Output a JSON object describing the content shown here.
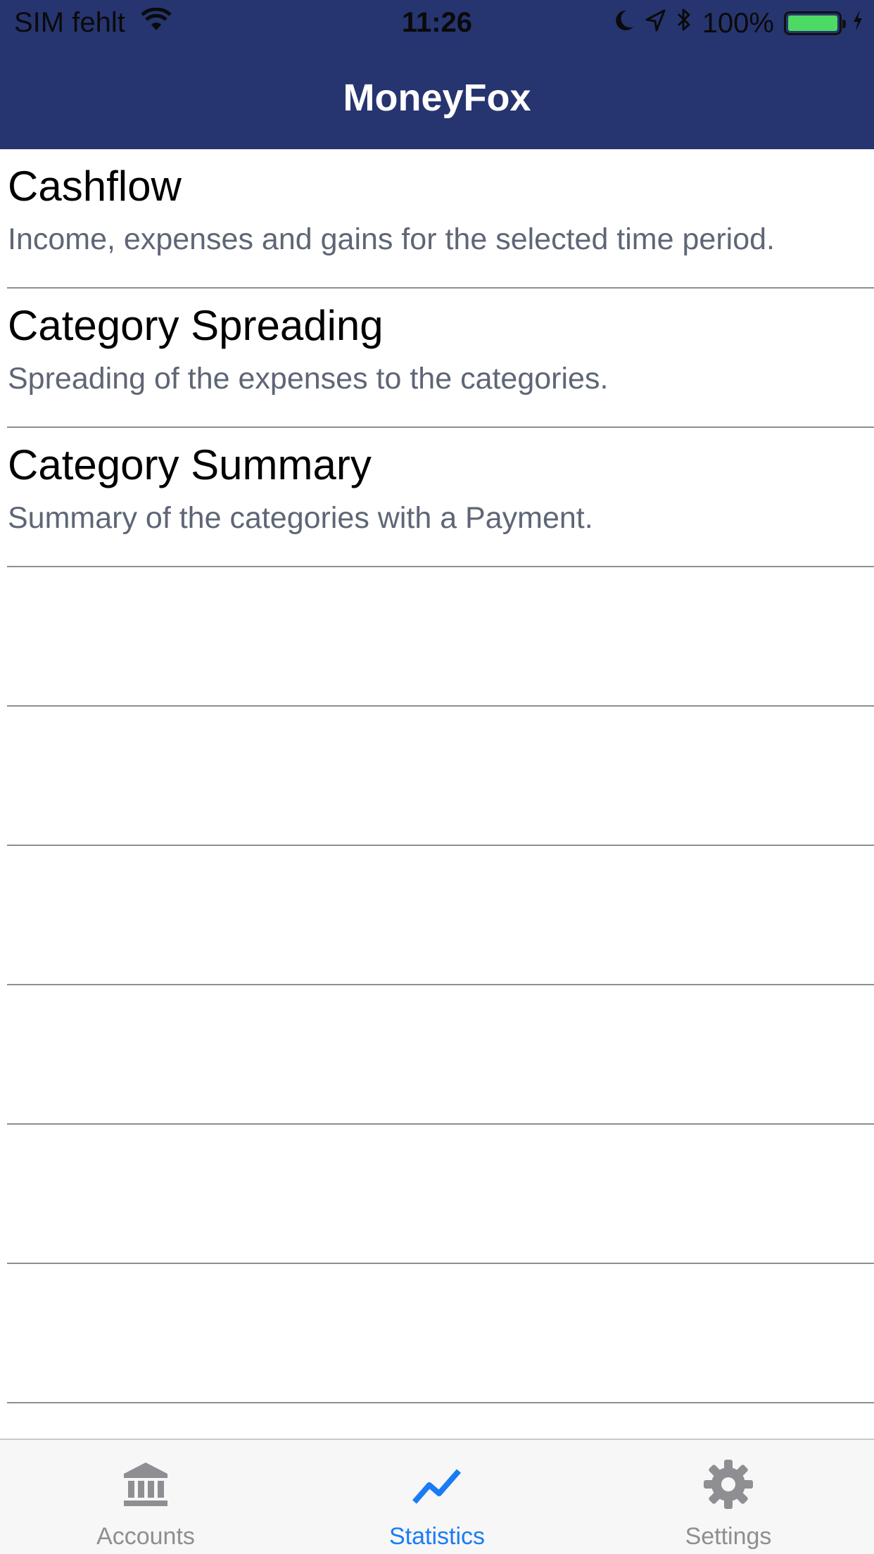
{
  "status_bar": {
    "carrier": "SIM fehlt",
    "time": "11:26",
    "battery_percent": "100%",
    "battery_level": 1.0,
    "icons": [
      "wifi-icon",
      "moon-icon",
      "location-arrow-icon",
      "bluetooth-icon",
      "battery-icon",
      "charging-bolt-icon"
    ]
  },
  "nav": {
    "title": "MoneyFox"
  },
  "list": {
    "items": [
      {
        "title": "Cashflow",
        "subtitle": "Income, expenses and gains for the selected time period."
      },
      {
        "title": "Category Spreading",
        "subtitle": "Spreading of the expenses to the categories."
      },
      {
        "title": "Category Summary",
        "subtitle": "Summary of the categories with a Payment."
      }
    ]
  },
  "tabbar": {
    "tabs": [
      {
        "label": "Accounts",
        "icon": "bank-icon",
        "active": false
      },
      {
        "label": "Statistics",
        "icon": "chart-line-icon",
        "active": true
      },
      {
        "label": "Settings",
        "icon": "gear-icon",
        "active": false
      }
    ]
  },
  "colors": {
    "nav_background": "#263570",
    "accent": "#1a7cf5",
    "inactive_tab": "#8e8e93",
    "subtitle_text": "#5e6676",
    "battery_fill": "#4cd964"
  }
}
